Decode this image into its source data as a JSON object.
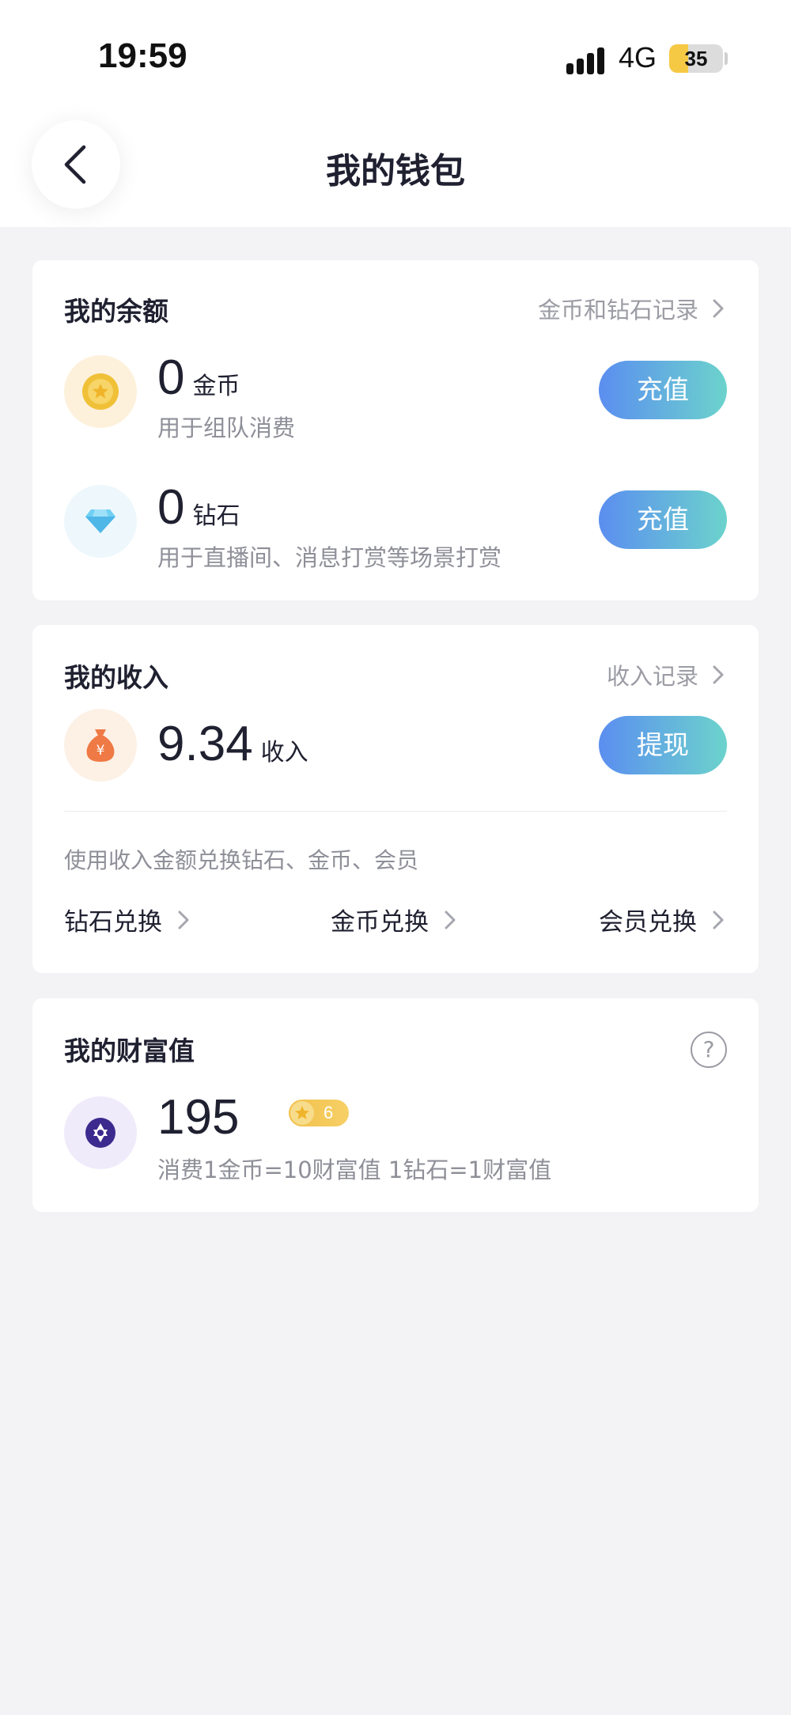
{
  "status_bar": {
    "time": "19:59",
    "network": "4G",
    "battery": "35",
    "battery_level": 0.35
  },
  "header": {
    "title": "我的钱包"
  },
  "balance": {
    "title": "我的余额",
    "records_link": "金币和钻石记录",
    "coins": {
      "amount": "0",
      "unit": "金币",
      "desc": "用于组队消费",
      "button": "充值"
    },
    "diamonds": {
      "amount": "0",
      "unit": "钻石",
      "desc": "用于直播间、消息打赏等场景打赏",
      "button": "充值"
    }
  },
  "income": {
    "title": "我的收入",
    "records_link": "收入记录",
    "amount": "9.34",
    "unit": "收入",
    "button": "提现",
    "hint": "使用收入金额兑换钻石、金币、会员",
    "exchanges": [
      "钻石兑换",
      "金币兑换",
      "会员兑换"
    ]
  },
  "wealth": {
    "title": "我的财富值",
    "help": "?",
    "value": "195",
    "level": "6",
    "desc": "消费1金币=10财富值 1钻石=1财富值"
  },
  "colors": {
    "background": "#f3f3f5",
    "button_gradient_start": "#5b8ef0",
    "button_gradient_end": "#6cd3cc",
    "coin": "#f0c037",
    "diamond": "#5bc4f0",
    "money_bag": "#ef7a45",
    "wealth": "#3d2a8e"
  },
  "icons": [
    "chevron-left-icon",
    "coin-icon",
    "diamond-icon",
    "money-bag-icon",
    "wealth-star-icon",
    "chevron-right-icon",
    "help-icon"
  ]
}
